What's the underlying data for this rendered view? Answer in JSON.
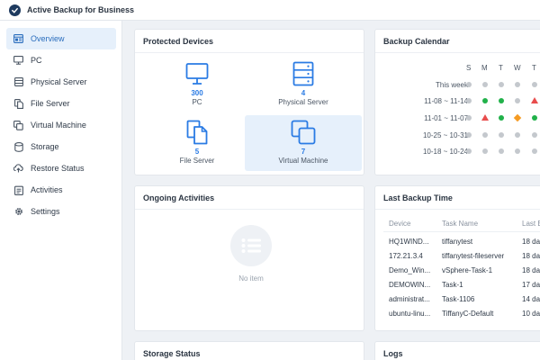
{
  "app": {
    "title": "Active Backup for Business"
  },
  "sidebar": {
    "items": [
      {
        "label": "Overview",
        "icon": "overview-icon",
        "active": true
      },
      {
        "label": "PC",
        "icon": "monitor-icon"
      },
      {
        "label": "Physical Server",
        "icon": "server-icon"
      },
      {
        "label": "File Server",
        "icon": "file-server-icon"
      },
      {
        "label": "Virtual Machine",
        "icon": "virtual-machine-icon"
      },
      {
        "label": "Storage",
        "icon": "storage-icon"
      },
      {
        "label": "Restore Status",
        "icon": "restore-icon"
      },
      {
        "label": "Activities",
        "icon": "activities-icon"
      },
      {
        "label": "Settings",
        "icon": "gear-icon"
      }
    ]
  },
  "protected_devices": {
    "title": "Protected Devices",
    "tiles": [
      {
        "count": "300",
        "name": "PC"
      },
      {
        "count": "4",
        "name": "Physical Server"
      },
      {
        "count": "5",
        "name": "File Server"
      },
      {
        "count": "7",
        "name": "Virtual Machine",
        "selected": true
      }
    ]
  },
  "backup_calendar": {
    "title": "Backup Calendar",
    "days": [
      "S",
      "M",
      "T",
      "W",
      "T"
    ],
    "rows": [
      {
        "label": "This week",
        "status": [
          "grey",
          "grey",
          "grey",
          "grey",
          "grey"
        ]
      },
      {
        "label": "11-08 ~ 11-14",
        "status": [
          "grey",
          "success",
          "success",
          "grey",
          "failed"
        ]
      },
      {
        "label": "11-01 ~ 11-07",
        "status": [
          "grey",
          "failed",
          "success",
          "warning",
          "success"
        ]
      },
      {
        "label": "10-25 ~ 10-31",
        "status": [
          "grey",
          "grey",
          "grey",
          "grey",
          "grey"
        ]
      },
      {
        "label": "10-18 ~ 10-24",
        "status": [
          "grey",
          "grey",
          "grey",
          "grey",
          "grey"
        ]
      }
    ]
  },
  "ongoing_activities": {
    "title": "Ongoing Activities",
    "empty_text": "No item"
  },
  "last_backup_time": {
    "title": "Last Backup Time",
    "columns": [
      "Device",
      "Task Name",
      "Last B"
    ],
    "rows": [
      {
        "device": "HQ1WIND...",
        "task": "tiffanytest",
        "last": "18 da"
      },
      {
        "device": "172.21.3.4",
        "task": "tiffanytest-fileserver",
        "last": "18 da"
      },
      {
        "device": "Demo_Win...",
        "task": "vSphere-Task-1",
        "last": "18 da"
      },
      {
        "device": "DEMOWIN...",
        "task": "Task-1",
        "last": "17 da"
      },
      {
        "device": "administrat...",
        "task": "Task-1106",
        "last": "14 da"
      },
      {
        "device": "ubuntu-linu...",
        "task": "TiffanyC-Default",
        "last": "10 da"
      }
    ]
  },
  "storage_status": {
    "title": "Storage Status"
  },
  "logs": {
    "title": "Logs"
  },
  "colors": {
    "accent": "#2a7be4",
    "success": "#21b14a",
    "failed": "#e84d4d",
    "warning": "#f59b23",
    "no_backup": "#c4c8cd"
  }
}
